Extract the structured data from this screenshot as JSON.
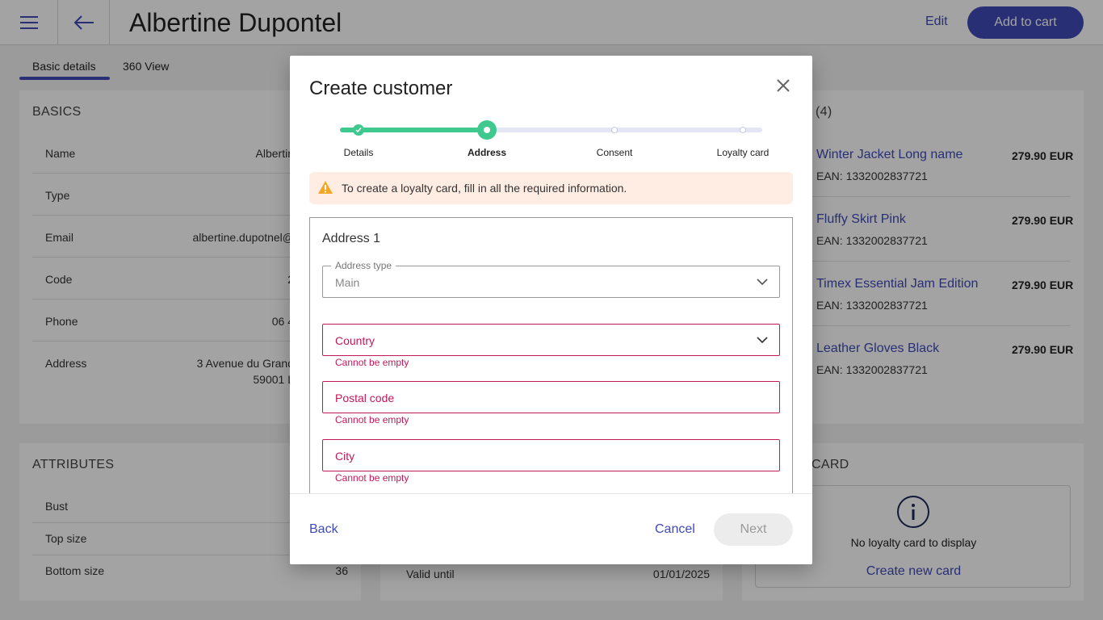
{
  "header": {
    "title": "Albertine Dupontel",
    "edit_label": "Edit",
    "cart_label": "Add to cart"
  },
  "tabs": [
    {
      "label": "Basic details",
      "active": true
    },
    {
      "label": "360 View",
      "active": false
    }
  ],
  "basics": {
    "title": "BASICS",
    "rows": [
      {
        "label": "Name",
        "value": "Albertin"
      },
      {
        "label": "Type",
        "value": ""
      },
      {
        "label": "Email",
        "value": "albertine.dupotnel@"
      },
      {
        "label": "Code",
        "value": "2"
      },
      {
        "label": "Phone",
        "value": "06 4"
      },
      {
        "label": "Address",
        "value": "3 Avenue du Grand",
        "value2": "59001 L"
      }
    ]
  },
  "cart": {
    "title_suffix": "(4)",
    "items": [
      {
        "name": "Winter Jacket Long name",
        "ean": "EAN: 1332002837721",
        "price": "279.90 EUR"
      },
      {
        "name": "Fluffy Skirt Pink",
        "ean": "EAN: 1332002837721",
        "price": "279.90 EUR"
      },
      {
        "name": "Timex Essential Jam Edition",
        "ean": "EAN: 1332002837721",
        "price": "279.90 EUR"
      },
      {
        "name": "Leather Gloves Black",
        "ean": "EAN: 1332002837721",
        "price": "279.90 EUR"
      }
    ]
  },
  "attributes": {
    "title": "ATTRIBUTES",
    "rows": [
      {
        "label": "Bust",
        "value": ""
      },
      {
        "label": "Top size",
        "value": ""
      },
      {
        "label": "Bottom size",
        "value": "36"
      }
    ]
  },
  "middle_card": {
    "valid_label": "Valid until",
    "valid_value": "01/01/2025"
  },
  "loyalty": {
    "title_suffix": "CARD",
    "empty_text": "No loyalty card to display",
    "create_label": "Create new card"
  },
  "modal": {
    "title": "Create customer",
    "steps": [
      {
        "label": "Details",
        "state": "done"
      },
      {
        "label": "Address",
        "state": "current"
      },
      {
        "label": "Consent",
        "state": "todo"
      },
      {
        "label": "Loyalty card",
        "state": "todo"
      }
    ],
    "warning": "To create a loyalty card, fill in all the required information.",
    "address_title": "Address 1",
    "address_type": {
      "legend": "Address type",
      "value": "Main"
    },
    "country": {
      "placeholder": "Country",
      "error": "Cannot be empty"
    },
    "postal_code": {
      "placeholder": "Postal code",
      "error": "Cannot be empty"
    },
    "city": {
      "placeholder": "City",
      "error": "Cannot be empty"
    },
    "back_label": "Back",
    "cancel_label": "Cancel",
    "next_label": "Next"
  },
  "colors": {
    "accent": "#3f4ab8",
    "success": "#3fc98e",
    "error": "#c2185b",
    "warning_bg": "#ffede3",
    "warning_icon": "#f5a623"
  }
}
